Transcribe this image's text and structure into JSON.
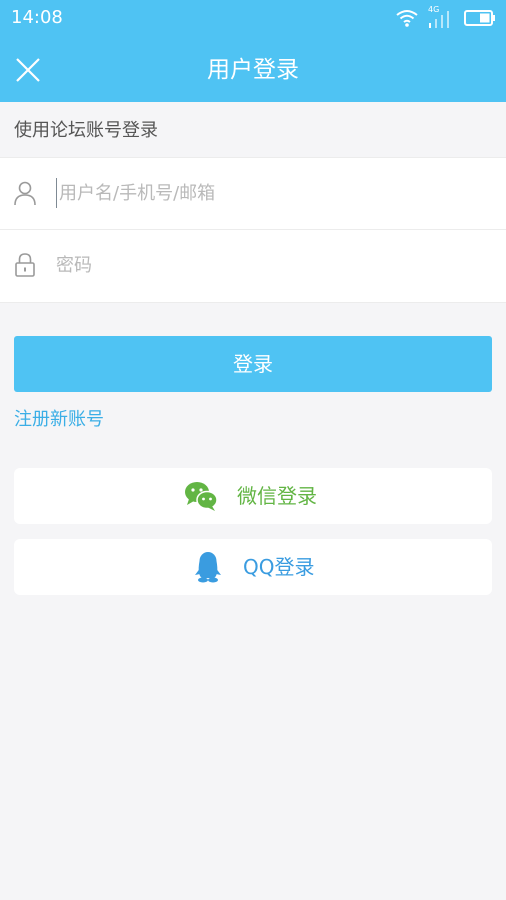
{
  "status_bar": {
    "time": "14:08",
    "network_label": "4G",
    "icons": [
      "wifi-icon",
      "signal-icon",
      "battery-icon"
    ]
  },
  "header": {
    "title": "用户登录",
    "close_icon": "close-icon",
    "background_color": "#4fc3f3"
  },
  "form": {
    "caption": "使用论坛账号登录",
    "username": {
      "icon": "user-icon",
      "placeholder": "用户名/手机号/邮箱",
      "value": ""
    },
    "password": {
      "icon": "lock-icon",
      "placeholder": "密码",
      "value": ""
    },
    "submit_label": "登录",
    "register_label": "注册新账号"
  },
  "social_login": [
    {
      "label": "微信登录",
      "icon": "wechat-icon",
      "color": "#62b544"
    },
    {
      "label": "QQ登录",
      "icon": "qq-icon",
      "color": "#3a9ce0"
    }
  ]
}
